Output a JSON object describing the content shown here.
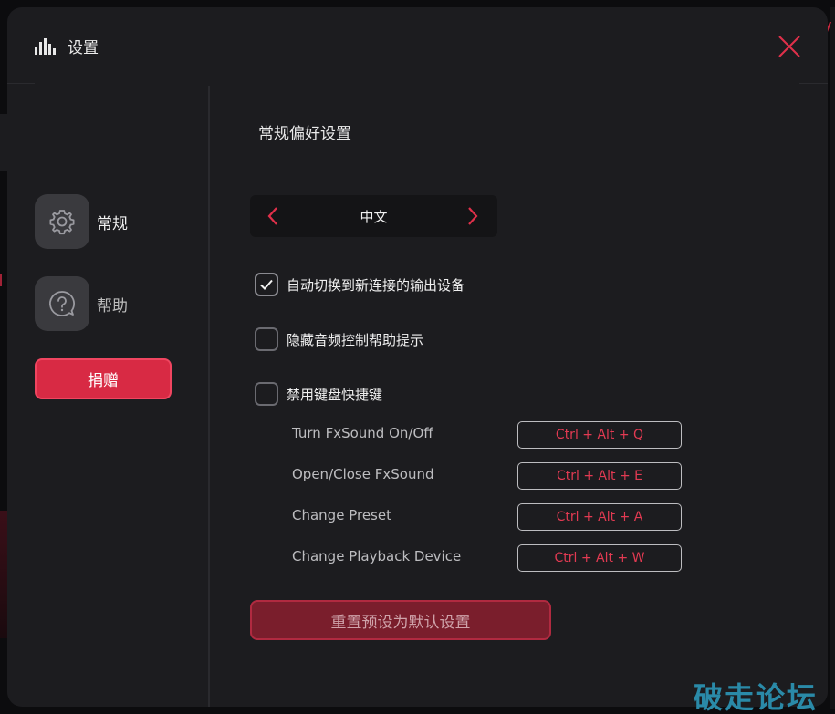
{
  "header": {
    "title": "设置"
  },
  "sidebar": {
    "items": [
      {
        "label": "常规",
        "icon": "gear-icon"
      },
      {
        "label": "帮助",
        "icon": "help-icon"
      }
    ],
    "donate_label": "捐赠"
  },
  "main": {
    "section_title": "常规偏好设置",
    "language": {
      "value": "中文"
    },
    "options": [
      {
        "label": "自动切换到新连接的输出设备",
        "checked": true
      },
      {
        "label": "隐藏音频控制帮助提示",
        "checked": false
      },
      {
        "label": "禁用键盘快捷键",
        "checked": false
      }
    ],
    "hotkeys": [
      {
        "label": "Turn FxSound On/Off",
        "keys": "Ctrl +  Alt + Q"
      },
      {
        "label": "Open/Close FxSound",
        "keys": "Ctrl +  Alt + E"
      },
      {
        "label": "Change Preset",
        "keys": "Ctrl +  Alt + A"
      },
      {
        "label": "Change Playback Device",
        "keys": "Ctrl +  Alt + W"
      }
    ],
    "reset_label": "重置预设为默认设置"
  },
  "watermark": "破走论坛",
  "colors": {
    "accent": "#d82a44",
    "hotkey_text": "#e23a52",
    "panel": "#1c1c1f"
  }
}
